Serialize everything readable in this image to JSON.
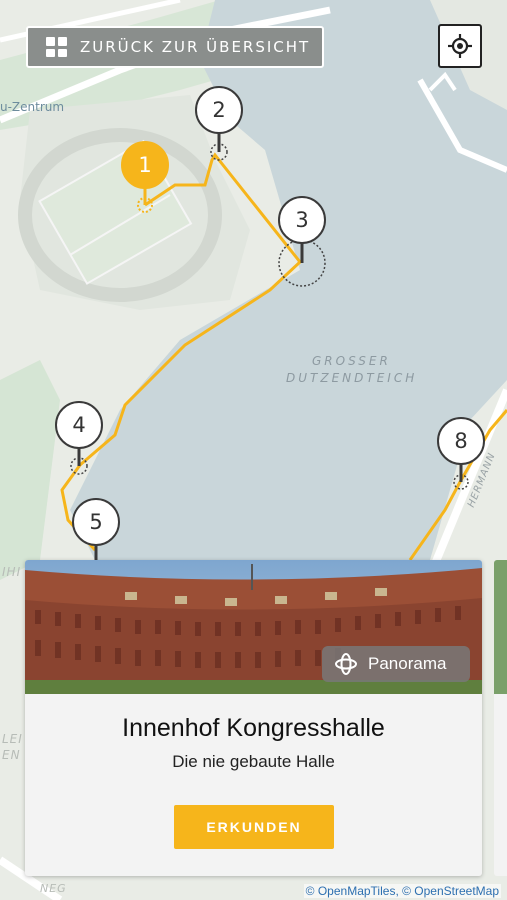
{
  "header": {
    "back_label": "ZURÜCK ZUR ÜBERSICHT",
    "back_icon": "grid-icon",
    "locate_icon": "crosshair-icon"
  },
  "map": {
    "labels": {
      "lake_line1": "GROSSER",
      "lake_line2": "DUTZENDTEICH",
      "zentrum": "u-Zentrum",
      "hermann": "HERMANN",
      "left_a": "IHI",
      "left_b": "LEI",
      "left_c": "EN",
      "bottom": "NEG"
    },
    "route_color": "#f6b51b",
    "water_color": "#c9d6da",
    "markers": [
      {
        "label": "1",
        "active": true
      },
      {
        "label": "2",
        "active": false
      },
      {
        "label": "3",
        "active": false
      },
      {
        "label": "4",
        "active": false
      },
      {
        "label": "5",
        "active": false
      },
      {
        "label": "8",
        "active": false
      }
    ]
  },
  "card": {
    "panorama_label": "Panorama",
    "title": "Innenhof Kongresshalle",
    "subtitle": "Die nie gebaute Halle",
    "button_label": "ERKUNDEN"
  },
  "attribution": {
    "part1": "© OpenMapTiles",
    "separator": ", ",
    "part2": "© OpenStreetMap"
  }
}
